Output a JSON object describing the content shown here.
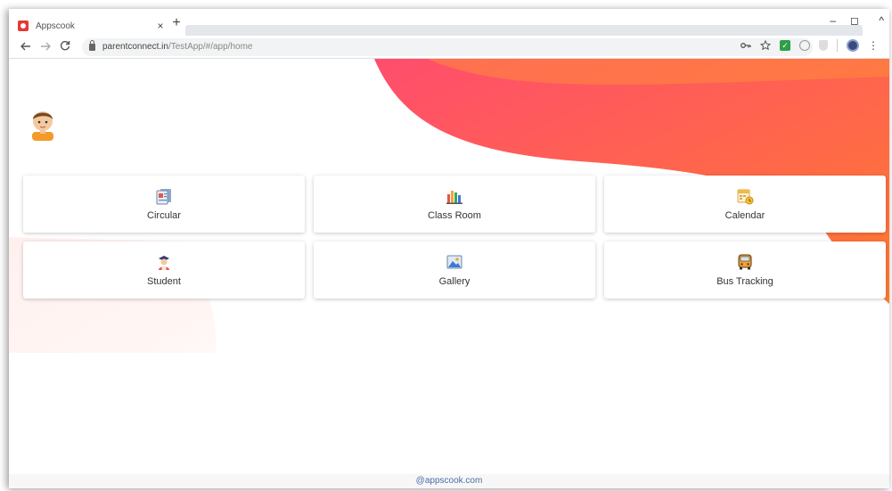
{
  "browser": {
    "tab_title": "Appscook",
    "tab_close": "×",
    "new_tab": "+",
    "url_host": "parentconnect.in",
    "url_path": "/TestApp/#/app/home",
    "window_controls": [
      "–",
      "◻",
      "^"
    ]
  },
  "colors": {
    "wave_start": "#ff4d6d",
    "wave_end": "#ff7a30",
    "footer_link": "#4a6ea8"
  },
  "menu": [
    {
      "label": "Circular",
      "icon": "circular-icon"
    },
    {
      "label": "Class Room",
      "icon": "classroom-icon"
    },
    {
      "label": "Calendar",
      "icon": "calendar-icon"
    },
    {
      "label": "Student",
      "icon": "student-icon"
    },
    {
      "label": "Gallery",
      "icon": "gallery-icon"
    },
    {
      "label": "Bus Tracking",
      "icon": "bus-icon"
    }
  ],
  "footer": {
    "text": "@appscook.com"
  }
}
